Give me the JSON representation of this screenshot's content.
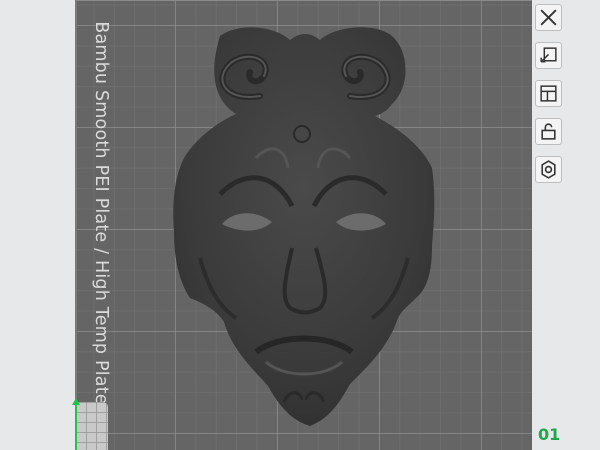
{
  "viewport": {
    "plate_label": "Bambu Smooth PEI Plate / High Temp Plate",
    "plate_index": "01"
  },
  "toolbar": {
    "items": [
      {
        "name": "close",
        "icon": "close-icon"
      },
      {
        "name": "auto-orient",
        "icon": "orient-icon"
      },
      {
        "name": "arrange",
        "icon": "arrange-icon"
      },
      {
        "name": "lock",
        "icon": "lock-icon"
      },
      {
        "name": "settings",
        "icon": "gear-icon"
      }
    ]
  },
  "colors": {
    "plate": "#656565",
    "model": "#3d3d3d",
    "axis": "#22c14a",
    "plate_index": "#1fa84a"
  }
}
